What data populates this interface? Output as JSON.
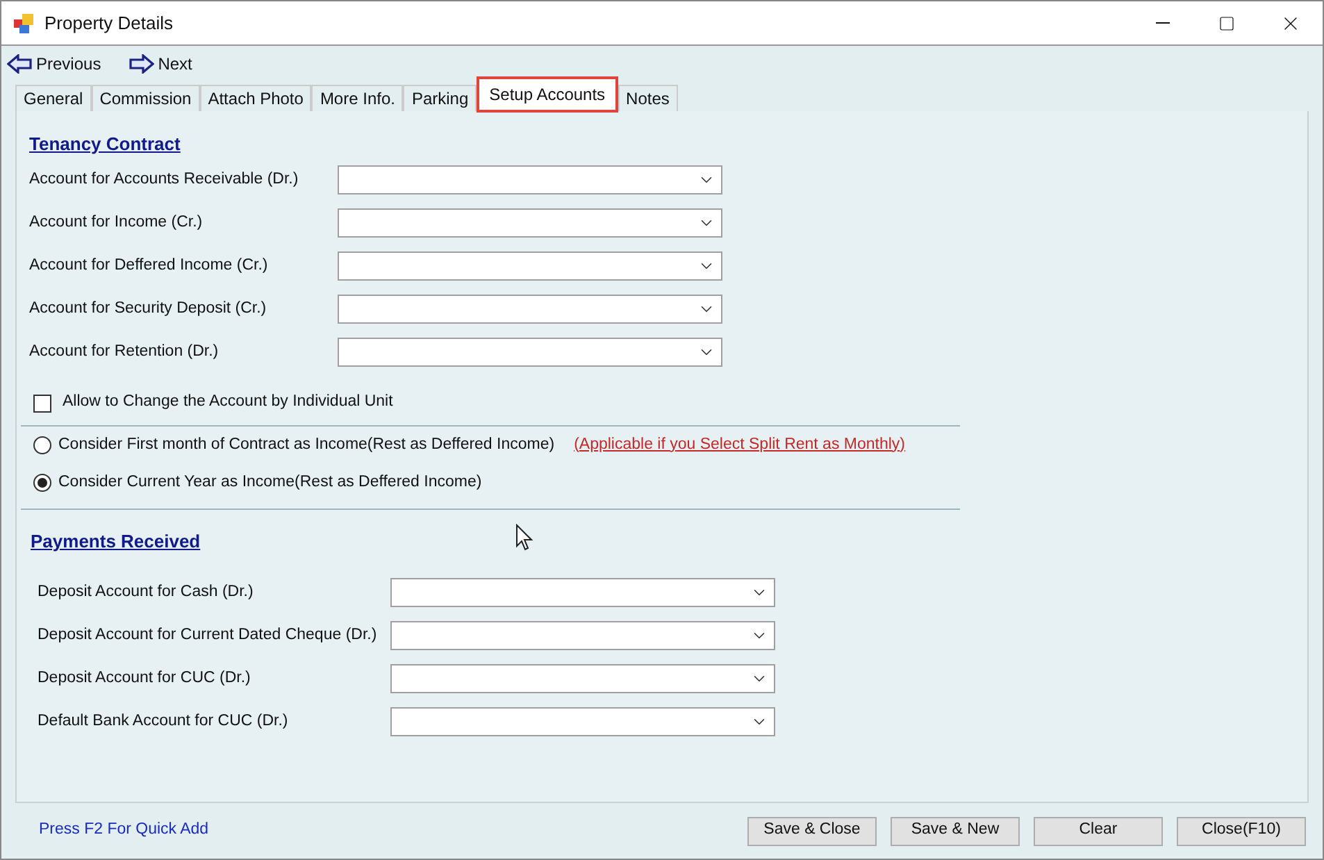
{
  "window": {
    "title": "Property Details"
  },
  "nav": [
    {
      "label": "Previous",
      "kind": "previous"
    },
    {
      "label": "Next",
      "kind": "next"
    }
  ],
  "tabs": [
    {
      "label": "General",
      "selected": false
    },
    {
      "label": "Commission",
      "selected": false
    },
    {
      "label": "Attach Photo",
      "selected": false
    },
    {
      "label": "More Info.",
      "selected": false
    },
    {
      "label": "Parking",
      "selected": false
    },
    {
      "label": "Setup Accounts",
      "selected": true
    },
    {
      "label": "Notes",
      "selected": false
    }
  ],
  "tenancy": {
    "heading": "Tenancy Contract",
    "fields": [
      {
        "label": "Account for Accounts Receivable (Dr.)"
      },
      {
        "label": "Account for Income (Cr.)"
      },
      {
        "label": "Account for Deffered Income (Cr.)"
      },
      {
        "label": "Account for Security Deposit (Cr.)"
      },
      {
        "label": "Account for Retention (Dr.)"
      }
    ]
  },
  "allow_change": {
    "label": "Allow to Change the Account by Individual Unit",
    "checked": false
  },
  "income_options": [
    {
      "label": "Consider First month of Contract as Income(Rest as Deffered Income)",
      "selected": false,
      "note": "(Applicable if you Select Split Rent as Monthly)"
    },
    {
      "label": "Consider Current Year as Income(Rest as Deffered Income)",
      "selected": true
    }
  ],
  "payments": {
    "heading": "Payments Received",
    "fields": [
      {
        "label": "Deposit Account for Cash (Dr.)"
      },
      {
        "label": "Deposit Account for Current Dated Cheque (Dr.)"
      },
      {
        "label": "Deposit Account for CUC (Dr.)"
      },
      {
        "label": "Default Bank Account for CUC (Dr.)"
      }
    ]
  },
  "footer": {
    "hint": "Press F2 For Quick Add"
  },
  "buttons": [
    "Save & Close",
    "Save & New",
    "Clear",
    "Close(F10)"
  ]
}
